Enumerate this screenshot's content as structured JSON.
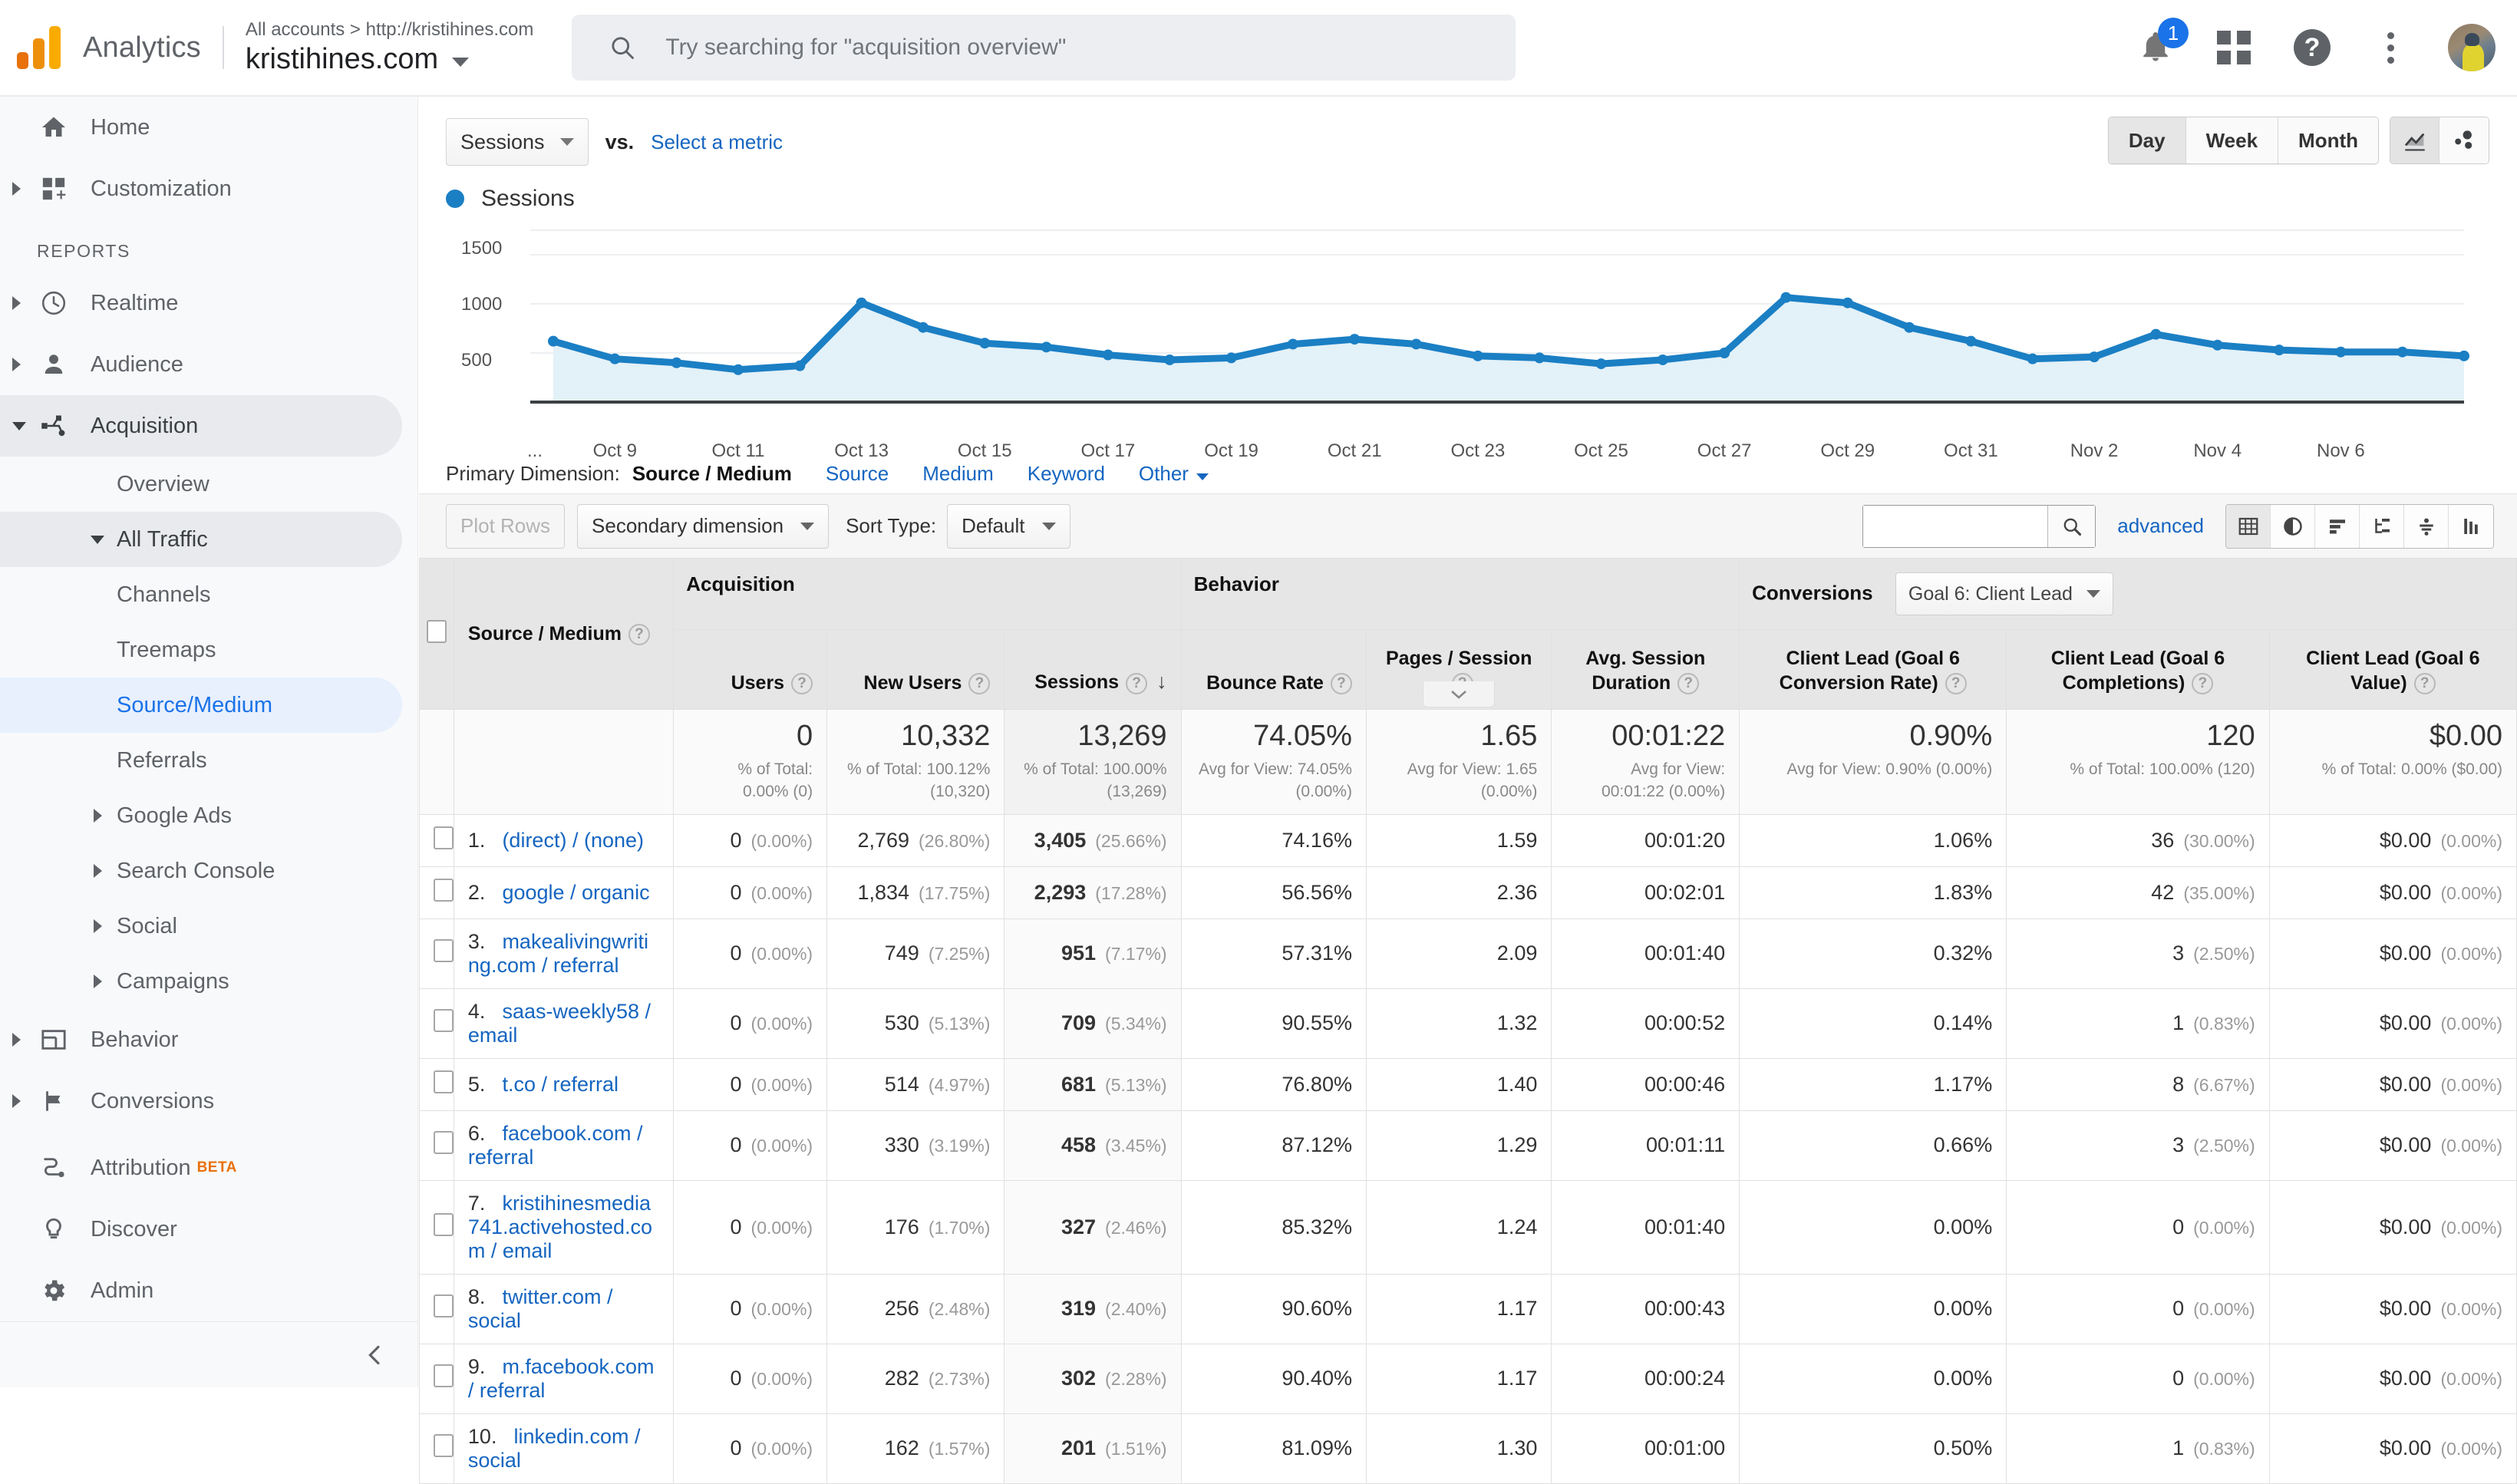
{
  "topbar": {
    "brand": "Analytics",
    "breadcrumb": "All accounts > http://kristihines.com",
    "account": "kristihines.com",
    "search_placeholder": "Try searching for \"acquisition overview\"",
    "notification_count": "1",
    "icons": [
      "bell-icon",
      "apps-grid-icon",
      "help-icon",
      "more-vert-icon",
      "avatar"
    ]
  },
  "sidebar": {
    "items": [
      {
        "label": "Home",
        "icon": "home-icon",
        "expandable": false
      },
      {
        "label": "Customization",
        "icon": "customization-icon",
        "expandable": true
      }
    ],
    "section_label": "REPORTS",
    "reports": [
      {
        "label": "Realtime",
        "icon": "clock-icon"
      },
      {
        "label": "Audience",
        "icon": "person-icon"
      },
      {
        "label": "Acquisition",
        "icon": "acquisition-icon",
        "active": true,
        "open": true
      },
      {
        "label": "Behavior",
        "icon": "behavior-icon"
      },
      {
        "label": "Conversions",
        "icon": "flag-icon"
      }
    ],
    "acquisition_children": [
      {
        "label": "Overview",
        "level": 2
      },
      {
        "label": "All Traffic",
        "level": 2,
        "open": true,
        "highlight": "grey"
      },
      {
        "label": "Channels",
        "level": 3
      },
      {
        "label": "Treemaps",
        "level": 3
      },
      {
        "label": "Source/Medium",
        "level": 3,
        "selected": true
      },
      {
        "label": "Referrals",
        "level": 3
      },
      {
        "label": "Google Ads",
        "level": 2,
        "expandable": true
      },
      {
        "label": "Search Console",
        "level": 2,
        "expandable": true
      },
      {
        "label": "Social",
        "level": 2,
        "expandable": true
      },
      {
        "label": "Campaigns",
        "level": 2,
        "expandable": true
      }
    ],
    "bottom": [
      {
        "label": "Attribution",
        "icon": "attribution-icon",
        "badge": "BETA"
      },
      {
        "label": "Discover",
        "icon": "bulb-icon"
      },
      {
        "label": "Admin",
        "icon": "gear-icon"
      }
    ],
    "collapse_icon": "chevron-left-icon"
  },
  "chart_controls": {
    "metric": "Sessions",
    "vs_label": "vs.",
    "select_metric": "Select a metric",
    "granularity": [
      "Day",
      "Week",
      "Month"
    ],
    "granularity_active": "Day",
    "chart_types": [
      "line-chart-icon",
      "motion-chart-icon"
    ],
    "chart_type_active": "line-chart-icon",
    "legend_label": "Sessions",
    "legend_color": "#1b7fc4"
  },
  "chart_data": {
    "type": "line",
    "title": "Sessions",
    "xlabel": "",
    "ylabel": "Sessions",
    "ylim": [
      0,
      1750
    ],
    "yticks": [
      500,
      1000,
      1500
    ],
    "grid": true,
    "legend": [
      "Sessions"
    ],
    "series_color": "#1b7fc4",
    "fill": true,
    "xtick_labels": [
      "...",
      "Oct 9",
      "Oct 11",
      "Oct 13",
      "Oct 15",
      "Oct 17",
      "Oct 19",
      "Oct 21",
      "Oct 23",
      "Oct 25",
      "Oct 27",
      "Oct 29",
      "Oct 31",
      "Nov 2",
      "Nov 4",
      "Nov 6"
    ],
    "x": [
      "Oct 7",
      "Oct 8",
      "Oct 9",
      "Oct 10",
      "Oct 11",
      "Oct 12",
      "Oct 13",
      "Oct 14",
      "Oct 15",
      "Oct 16",
      "Oct 17",
      "Oct 18",
      "Oct 19",
      "Oct 20",
      "Oct 21",
      "Oct 22",
      "Oct 23",
      "Oct 24",
      "Oct 25",
      "Oct 26",
      "Oct 27",
      "Oct 28",
      "Oct 29",
      "Oct 30",
      "Oct 31",
      "Nov 1",
      "Nov 2",
      "Nov 3",
      "Nov 4",
      "Nov 5",
      "Nov 6",
      "Nov 7"
    ],
    "values": [
      620,
      440,
      400,
      330,
      370,
      1010,
      760,
      600,
      560,
      480,
      430,
      450,
      590,
      640,
      590,
      470,
      450,
      390,
      430,
      500,
      1065,
      1010,
      760,
      620,
      440,
      460,
      690,
      580,
      530,
      510,
      510,
      470
    ]
  },
  "primary_dimension": {
    "label": "Primary Dimension:",
    "current": "Source / Medium",
    "links": [
      "Source",
      "Medium",
      "Keyword",
      "Other"
    ]
  },
  "toolbar": {
    "plot_rows": "Plot Rows",
    "secondary_dimension": "Secondary dimension",
    "sort_type_label": "Sort Type:",
    "sort_type_value": "Default",
    "search_value": "",
    "advanced": "advanced",
    "view_icons": [
      "table-view-icon",
      "pie-view-icon",
      "bar-view-icon",
      "comparison-view-icon",
      "pivot-view-icon",
      "performance-view-icon"
    ],
    "view_active": "table-view-icon"
  },
  "table": {
    "groups": [
      {
        "label": "Acquisition",
        "span": 3
      },
      {
        "label": "Behavior",
        "span": 3
      },
      {
        "label": "Conversions",
        "span": 3,
        "selector": "Goal 6: Client Lead"
      }
    ],
    "dimension_header": "Source / Medium",
    "columns": [
      "Users",
      "New Users",
      "Sessions",
      "Bounce Rate",
      "Pages / Session",
      "Avg. Session Duration",
      "Client Lead (Goal 6 Conversion Rate)",
      "Client Lead (Goal 6 Completions)",
      "Client Lead (Goal 6 Value)"
    ],
    "sorted_column": "Sessions",
    "sort_direction": "desc",
    "summary": [
      {
        "value": "0",
        "sub": "% of Total: 0.00% (0)"
      },
      {
        "value": "10,332",
        "sub": "% of Total: 100.12% (10,320)"
      },
      {
        "value": "13,269",
        "sub": "% of Total: 100.00% (13,269)"
      },
      {
        "value": "74.05%",
        "sub": "Avg for View: 74.05% (0.00%)"
      },
      {
        "value": "1.65",
        "sub": "Avg for View: 1.65 (0.00%)"
      },
      {
        "value": "00:01:22",
        "sub": "Avg for View: 00:01:22 (0.00%)"
      },
      {
        "value": "0.90%",
        "sub": "Avg for View: 0.90% (0.00%)"
      },
      {
        "value": "120",
        "sub": "% of Total: 100.00% (120)"
      },
      {
        "value": "$0.00",
        "sub": "% of Total: 0.00% ($0.00)"
      }
    ],
    "rows": [
      {
        "idx": "1.",
        "dim": "(direct) / (none)",
        "users": "0",
        "users_pct": "(0.00%)",
        "new_users": "2,769",
        "new_users_pct": "(26.80%)",
        "sessions": "3,405",
        "sessions_pct": "(25.66%)",
        "bounce": "74.16%",
        "pages": "1.59",
        "duration": "00:01:20",
        "conv_rate": "1.06%",
        "completions": "36",
        "completions_pct": "(30.00%)",
        "value": "$0.00",
        "value_pct": "(0.00%)"
      },
      {
        "idx": "2.",
        "dim": "google / organic",
        "users": "0",
        "users_pct": "(0.00%)",
        "new_users": "1,834",
        "new_users_pct": "(17.75%)",
        "sessions": "2,293",
        "sessions_pct": "(17.28%)",
        "bounce": "56.56%",
        "pages": "2.36",
        "duration": "00:02:01",
        "conv_rate": "1.83%",
        "completions": "42",
        "completions_pct": "(35.00%)",
        "value": "$0.00",
        "value_pct": "(0.00%)"
      },
      {
        "idx": "3.",
        "dim": "makealivingwriting.com / referral",
        "users": "0",
        "users_pct": "(0.00%)",
        "new_users": "749",
        "new_users_pct": "(7.25%)",
        "sessions": "951",
        "sessions_pct": "(7.17%)",
        "bounce": "57.31%",
        "pages": "2.09",
        "duration": "00:01:40",
        "conv_rate": "0.32%",
        "completions": "3",
        "completions_pct": "(2.50%)",
        "value": "$0.00",
        "value_pct": "(0.00%)"
      },
      {
        "idx": "4.",
        "dim": "saas-weekly58 / email",
        "users": "0",
        "users_pct": "(0.00%)",
        "new_users": "530",
        "new_users_pct": "(5.13%)",
        "sessions": "709",
        "sessions_pct": "(5.34%)",
        "bounce": "90.55%",
        "pages": "1.32",
        "duration": "00:00:52",
        "conv_rate": "0.14%",
        "completions": "1",
        "completions_pct": "(0.83%)",
        "value": "$0.00",
        "value_pct": "(0.00%)"
      },
      {
        "idx": "5.",
        "dim": "t.co / referral",
        "users": "0",
        "users_pct": "(0.00%)",
        "new_users": "514",
        "new_users_pct": "(4.97%)",
        "sessions": "681",
        "sessions_pct": "(5.13%)",
        "bounce": "76.80%",
        "pages": "1.40",
        "duration": "00:00:46",
        "conv_rate": "1.17%",
        "completions": "8",
        "completions_pct": "(6.67%)",
        "value": "$0.00",
        "value_pct": "(0.00%)"
      },
      {
        "idx": "6.",
        "dim": "facebook.com / referral",
        "users": "0",
        "users_pct": "(0.00%)",
        "new_users": "330",
        "new_users_pct": "(3.19%)",
        "sessions": "458",
        "sessions_pct": "(3.45%)",
        "bounce": "87.12%",
        "pages": "1.29",
        "duration": "00:01:11",
        "conv_rate": "0.66%",
        "completions": "3",
        "completions_pct": "(2.50%)",
        "value": "$0.00",
        "value_pct": "(0.00%)"
      },
      {
        "idx": "7.",
        "dim": "kristihinesmedia741.activehosted.com / email",
        "users": "0",
        "users_pct": "(0.00%)",
        "new_users": "176",
        "new_users_pct": "(1.70%)",
        "sessions": "327",
        "sessions_pct": "(2.46%)",
        "bounce": "85.32%",
        "pages": "1.24",
        "duration": "00:01:40",
        "conv_rate": "0.00%",
        "completions": "0",
        "completions_pct": "(0.00%)",
        "value": "$0.00",
        "value_pct": "(0.00%)"
      },
      {
        "idx": "8.",
        "dim": "twitter.com / social",
        "users": "0",
        "users_pct": "(0.00%)",
        "new_users": "256",
        "new_users_pct": "(2.48%)",
        "sessions": "319",
        "sessions_pct": "(2.40%)",
        "bounce": "90.60%",
        "pages": "1.17",
        "duration": "00:00:43",
        "conv_rate": "0.00%",
        "completions": "0",
        "completions_pct": "(0.00%)",
        "value": "$0.00",
        "value_pct": "(0.00%)"
      },
      {
        "idx": "9.",
        "dim": "m.facebook.com / referral",
        "users": "0",
        "users_pct": "(0.00%)",
        "new_users": "282",
        "new_users_pct": "(2.73%)",
        "sessions": "302",
        "sessions_pct": "(2.28%)",
        "bounce": "90.40%",
        "pages": "1.17",
        "duration": "00:00:24",
        "conv_rate": "0.00%",
        "completions": "0",
        "completions_pct": "(0.00%)",
        "value": "$0.00",
        "value_pct": "(0.00%)"
      },
      {
        "idx": "10.",
        "dim": "linkedin.com / social",
        "users": "0",
        "users_pct": "(0.00%)",
        "new_users": "162",
        "new_users_pct": "(1.57%)",
        "sessions": "201",
        "sessions_pct": "(1.51%)",
        "bounce": "81.09%",
        "pages": "1.30",
        "duration": "00:01:00",
        "conv_rate": "0.50%",
        "completions": "1",
        "completions_pct": "(0.83%)",
        "value": "$0.00",
        "value_pct": "(0.00%)"
      }
    ]
  }
}
